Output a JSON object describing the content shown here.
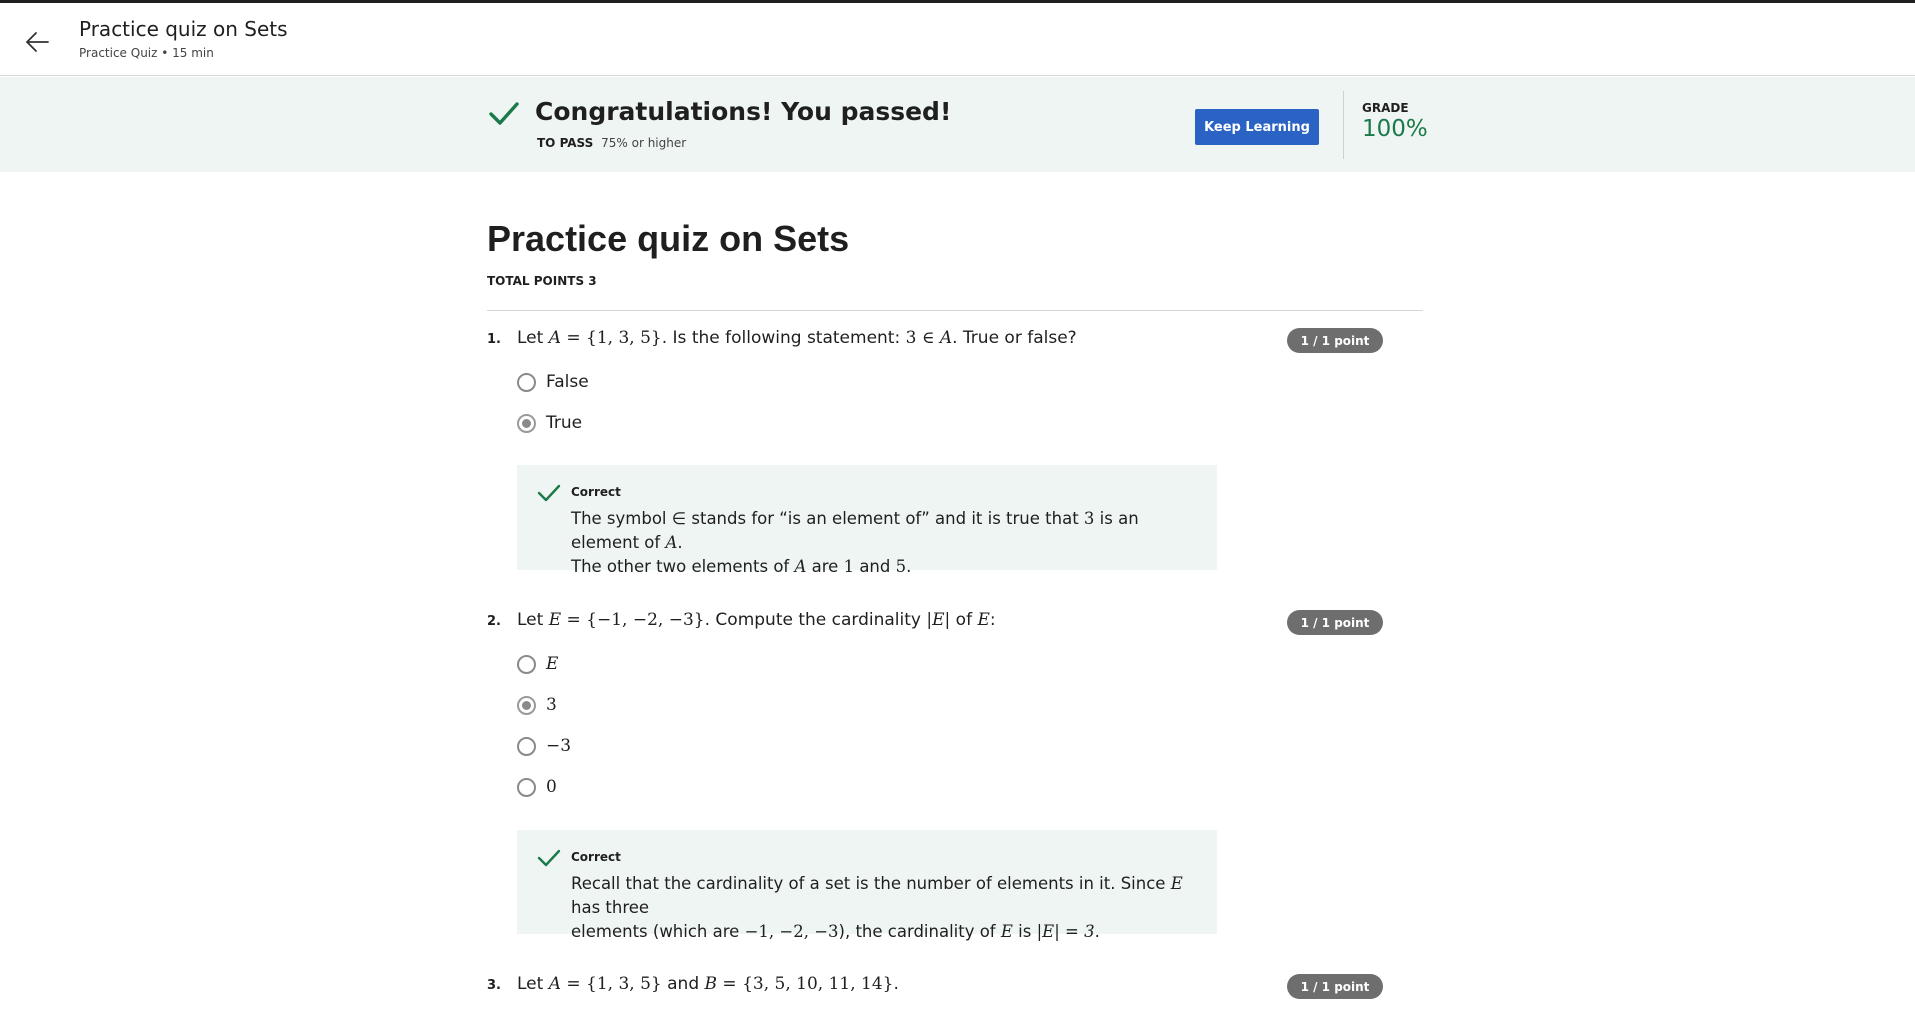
{
  "header": {
    "title": "Practice quiz on Sets",
    "subtitle": "Practice Quiz • 15 min",
    "back_icon": "arrow-left-icon"
  },
  "banner": {
    "title": "Congratulations! You passed!",
    "to_pass_label": "TO PASS",
    "to_pass_value": "75% or higher",
    "keep_learning": "Keep Learning",
    "grade_label": "GRADE",
    "grade_value": "100%",
    "accent_color": "#1b7a4a",
    "button_color": "#2a63c4"
  },
  "quiz": {
    "title": "Practice quiz on Sets",
    "total_points": "TOTAL POINTS 3"
  },
  "questions": [
    {
      "number": "1.",
      "points": "1 / 1 point",
      "text": {
        "p1": "Let ",
        "m1": "A",
        "m2": " = {1, 3, 5}",
        "p2": ". Is the following statement: ",
        "m3": "3 ∈ ",
        "m4": "A",
        "p3": ". True or false?"
      },
      "options": [
        {
          "label": "False",
          "selected": false
        },
        {
          "label": "True",
          "selected": true
        }
      ],
      "feedback": {
        "title": "Correct",
        "line1": {
          "p1": "The symbol ∈ stands for “is an element of” and it is true that ",
          "m1": "3",
          "p2": " is an element of ",
          "m2": "A",
          "p3": "."
        },
        "line2": {
          "p1": "The other two elements of ",
          "m1": "A",
          "p2": " are ",
          "m2": "1",
          "p3": " and ",
          "m3": "5",
          "p4": "."
        }
      }
    },
    {
      "number": "2.",
      "points": "1 / 1 point",
      "text": {
        "p1": "Let ",
        "m1": "E",
        "m2": " = {−1, −2, −3}",
        "p2": ". Compute the cardinality ",
        "m3": "|E|",
        "p3": " of ",
        "m4": "E",
        "p4": ":"
      },
      "options": [
        {
          "label": "E",
          "selected": false
        },
        {
          "label": "3",
          "selected": true
        },
        {
          "label": "−3",
          "selected": false
        },
        {
          "label": "0",
          "selected": false
        }
      ],
      "feedback": {
        "title": "Correct",
        "line1": {
          "p1": "Recall that the cardinality of a set is the number of elements in it. Since ",
          "m1": "E",
          "p2": " has three"
        },
        "line2": {
          "p1": "elements (which are ",
          "m1": "−1, −2, −3",
          "p2": "), the cardinality of ",
          "m2": "E",
          "p3": " is ",
          "m3": "|E| = 3",
          "p4": "."
        }
      }
    },
    {
      "number": "3.",
      "points": "1 / 1 point",
      "text": {
        "p1": "Let ",
        "m1": "A",
        "m2": " = {1, 3, 5}",
        "p2": " and ",
        "m3": "B",
        "m4": " = {3, 5, 10, 11, 14}",
        "p3": "."
      }
    }
  ]
}
